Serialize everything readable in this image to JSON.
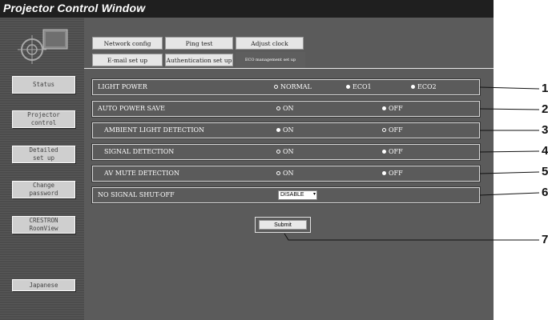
{
  "window": {
    "title": "Projector Control Window"
  },
  "sidebar": {
    "logo_icon": "projector-logo-icon",
    "items": [
      {
        "label": "Status"
      },
      {
        "label": "Projector\ncontrol"
      },
      {
        "label": "Detailed\nset up"
      },
      {
        "label": "Change\npassword"
      },
      {
        "label": "CRESTRON\nRoomView"
      },
      {
        "label": "Japanese"
      }
    ]
  },
  "tabs": {
    "network_config": "Network config",
    "ping_test": "Ping test",
    "adjust_clock": "Adjust clock",
    "email_setup": "E-mail set up",
    "authentication_setup": "Authentication set up",
    "eco_management_setup": "ECO management set up"
  },
  "settings": {
    "light_power": {
      "label": "LIGHT POWER",
      "options": [
        "NORMAL",
        "ECO1",
        "ECO2"
      ],
      "selected": "ECO1"
    },
    "auto_power_save": {
      "label": "AUTO POWER SAVE",
      "on": "ON",
      "off": "OFF",
      "selected": "OFF"
    },
    "ambient_light_detection": {
      "label": "AMBIENT LIGHT DETECTION",
      "on": "ON",
      "off": "OFF",
      "selected": "ON"
    },
    "signal_detection": {
      "label": "SIGNAL DETECTION",
      "on": "ON",
      "off": "OFF",
      "selected": "OFF"
    },
    "av_mute_detection": {
      "label": "AV MUTE DETECTION",
      "on": "ON",
      "off": "OFF",
      "selected": "OFF"
    },
    "no_signal_shut_off": {
      "label": "NO SIGNAL SHUT-OFF",
      "value": "DISABLE"
    }
  },
  "submit_label": "Submit",
  "callouts": [
    "1",
    "2",
    "3",
    "4",
    "5",
    "6",
    "7"
  ]
}
